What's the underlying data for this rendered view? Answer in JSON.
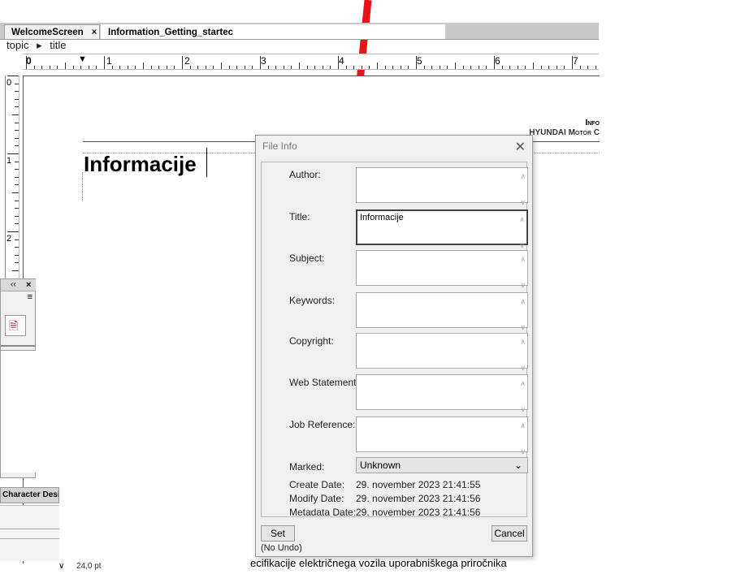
{
  "tabs": [
    {
      "label": "WelcomeScreen",
      "close": "×"
    },
    {
      "label": "Information_Getting_startec"
    }
  ],
  "breadcrumb": {
    "item1": "topic",
    "separator": "▸",
    "item2": "title"
  },
  "ruler": {
    "labels": [
      "0",
      "1",
      "2",
      "3",
      "4",
      "5",
      "6",
      "7"
    ]
  },
  "vruler": {
    "labels": [
      "0",
      "1",
      "2"
    ]
  },
  "document": {
    "header_line1": "Info",
    "header_line2": "HYUNDAI Motor C",
    "heading": "Informacije",
    "footer_text": "ecifikacije električnega vozila uporabniškega priročnika",
    "footer_size": "24,0 pt"
  },
  "panel": {
    "collapse": "‹‹",
    "close": "×",
    "menu": "≡",
    "char_design_label": "Character Desig"
  },
  "dialog": {
    "title": "File Info",
    "close": "✕",
    "fields": {
      "author_label": "Author:",
      "author_value": "",
      "title_label": "Title:",
      "title_value": "Informacije",
      "subject_label": "Subject:",
      "subject_value": "",
      "keywords_label": "Keywords:",
      "keywords_value": "",
      "copyright_label": "Copyright:",
      "copyright_value": "",
      "web_label": "Web Statement:",
      "web_value": "",
      "job_label": "Job Reference:",
      "job_value": "",
      "marked_label": "Marked:",
      "marked_value": "Unknown"
    },
    "dates": {
      "create_label": "Create Date:",
      "create_value": "29. november 2023 21:41:55",
      "modify_label": "Modify Date:",
      "modify_value": "29. november 2023 21:41:56",
      "metadata_label": "Metadata Date:",
      "metadata_value": "29. november 2023 21:41:56"
    },
    "buttons": {
      "set": "Set",
      "cancel": "Cancel"
    },
    "undo_status": "(No Undo)"
  },
  "colors": {
    "arrow": "#e8141a"
  }
}
